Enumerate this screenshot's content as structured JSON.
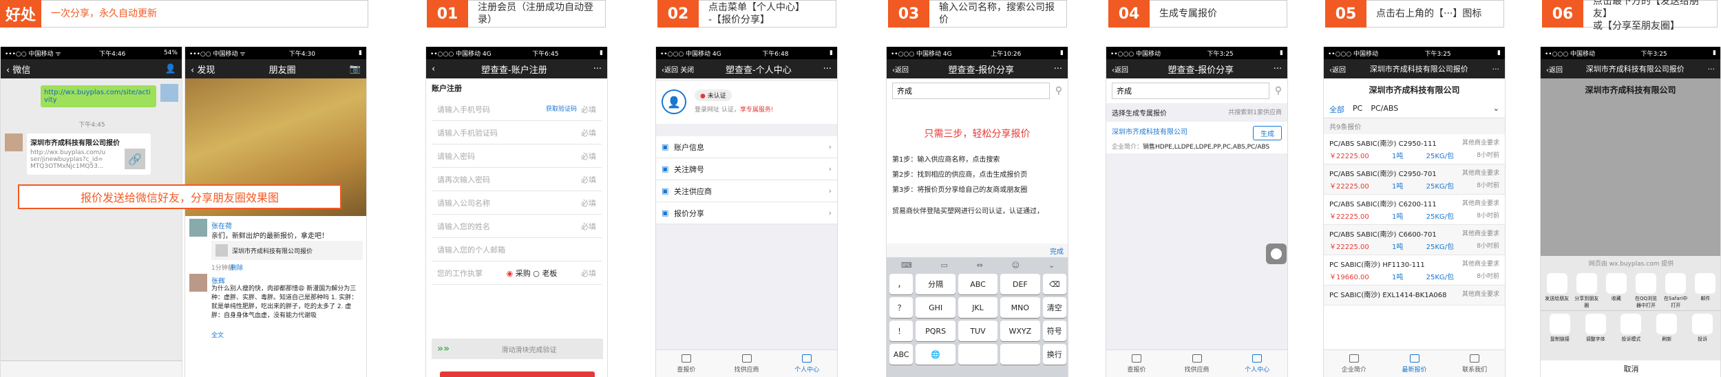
{
  "steps": [
    {
      "num": "好处",
      "text": "一次分享，永久自动更新"
    },
    {
      "num": "01",
      "text": "注册会员（注册成功自动登录）"
    },
    {
      "num": "02",
      "text1": "点击菜单【个人中心】",
      "text2": "-【报价分享】"
    },
    {
      "num": "03",
      "text": "输入公司名称，搜索公司报价"
    },
    {
      "num": "04",
      "text": "生成专属报价"
    },
    {
      "num": "05",
      "text": "点击右上角的【···】图标"
    },
    {
      "num": "06",
      "text1": "点击最下方的【发送给朋友】",
      "text2": "或【分享至朋友圈】"
    }
  ],
  "p1": {
    "status": "•••○○ 中国移动 ᯤ",
    "time": "下午4:46",
    "batt": "54%",
    "back": "微信",
    "link": "http://wx.buyplas.com/site/activity",
    "timestamp": "下午4:45",
    "card_title": "深圳市齐成科技有限公司报价",
    "card_url": "http://wx.buyplas.com/user/jinewbuyplas?c_id=MTQ3OTMxNjc1MQ53..."
  },
  "p1b": {
    "status": "•••○○ 中国移动 ᯤ",
    "time": "下午4:30",
    "back": "发现",
    "title": "朋友圈",
    "user": "张在荷",
    "post": "亲们，新鲜出炉的最新报价，拿走吧！",
    "share": "深圳市齐成科技有限公司报价",
    "ago": "1分钟前",
    "del": "删除",
    "user2": "张辉",
    "post2": "为什么别人瘦的快，肉卻都那惜😩 新漫国为解分为三种：虚胖、实胖、毒胖。知道自己是那种吗 1. 实胖：就是单纯性肥胖，吃出来的胖子，吃的太多了 2. 虚胖：自身身体气血虚，没有能力代谢吸",
    "more": "全文"
  },
  "overlay": "报价发送给微信好友，分享朋友圈效果图",
  "p2": {
    "status": "••○○○ 中国移动 4G",
    "time": "下午6:45",
    "title": "塑查查-账户注册",
    "section": "账户注册",
    "fields": [
      {
        "ph": "请输入手机号码",
        "extra": "获取验证码",
        "req": "必填"
      },
      {
        "ph": "请输入手机验证码",
        "req": "必填"
      },
      {
        "ph": "请输入密码",
        "req": "必填"
      },
      {
        "ph": "请再次输入密码",
        "req": "必填"
      },
      {
        "ph": "请输入公司名称",
        "req": "必填"
      },
      {
        "ph": "请输入您的姓名",
        "req": "必填"
      },
      {
        "ph": "请输入您的个人邮箱",
        "req": ""
      }
    ],
    "role_label": "您的工作执掌",
    "role1": "采购",
    "role2": "老板",
    "slider": "滑动滑块完成验证"
  },
  "p3": {
    "status": "••○○○ 中国移动 4G",
    "time": "下午6:48",
    "back": "返回",
    "close": "关闭",
    "title": "塑查查-个人中心",
    "badge": "未认证",
    "hint1": "登录网址",
    "hint2": "认证，",
    "hint3": "享专属服务!",
    "menu": [
      "账户信息",
      "关注牌号",
      "关注供应商",
      "报价分享"
    ],
    "tabs": [
      "查报价",
      "找供应商",
      "个人中心"
    ]
  },
  "p4": {
    "status": "••○○○ 中国移动 4G",
    "time": "上午10:26",
    "back": "返回",
    "title": "塑查查-报价分享",
    "search": "齐成",
    "promo": "只需三步，轻松分享报价",
    "s1": "第1步：输入供应商名称，点击搜索",
    "s2": "第2步：找到相应的供应商，点击生成报价页",
    "s3": "第3步：将报价页分享给自己的友商或朋友圈",
    "note": "贸易商伙伴登陆买塑网进行公司认证，认证通过，",
    "done": "完成",
    "keys": [
      [
        "，",
        "分隔",
        "ABC",
        "DEF",
        "⌫"
      ],
      [
        "？",
        "GHI",
        "JKL",
        "MNO",
        "清空"
      ],
      [
        "！",
        "PQRS",
        "TUV",
        "WXYZ",
        "符号"
      ],
      [
        "ABC",
        "🌐",
        "",
        "",
        "换行"
      ]
    ]
  },
  "p5": {
    "status": "••○○○ 中国移动",
    "time": "下午3:25",
    "back": "返回",
    "title": "塑查查-报价分享",
    "search": "齐成",
    "head": "选择生成专属报价",
    "count": "共搜索到1家供应商",
    "company": "深圳市齐成科技有限公司",
    "btn": "生成",
    "label": "企业简介：",
    "desc": "销售HDPE,LLDPE,LDPE,PP,PC,ABS,PC/ABS",
    "tabs": [
      "查报价",
      "找供应商",
      "个人中心"
    ]
  },
  "p6": {
    "status": "••○○○ 中国移动",
    "time": "下午3:25",
    "back": "返回",
    "title": "深圳市齐成科技有限公司报价",
    "company": "深圳市齐成科技有限公司",
    "filters": [
      "全部",
      "PC",
      "PC/ABS"
    ],
    "count": "共9条报价",
    "items": [
      {
        "a": "PC/ABS",
        "b": "SABIC(南沙)",
        "c": "C2950-111",
        "d": "其他商业要求",
        "p": "￥22225.00",
        "q": "1吨",
        "s": "25KG/包",
        "t": "8小时前"
      },
      {
        "a": "PC/ABS",
        "b": "SABIC(南沙)",
        "c": "C2950-701",
        "d": "其他商业要求",
        "p": "￥22225.00",
        "q": "1吨",
        "s": "25KG/包",
        "t": "8小时前"
      },
      {
        "a": "PC/ABS",
        "b": "SABIC(南沙)",
        "c": "C6200-111",
        "d": "其他商业要求",
        "p": "￥22225.00",
        "q": "1吨",
        "s": "25KG/包",
        "t": "8小时前"
      },
      {
        "a": "PC/ABS",
        "b": "SABIC(南沙)",
        "c": "C6600-701",
        "d": "其他商业要求",
        "p": "￥22225.00",
        "q": "1吨",
        "s": "25KG/包",
        "t": "8小时前"
      },
      {
        "a": "PC",
        "b": "SABIC(南沙)",
        "c": "HF1130-111",
        "d": "其他商业要求",
        "p": "￥19660.00",
        "q": "1吨",
        "s": "25KG/包",
        "t": "8小时前"
      },
      {
        "a": "PC",
        "b": "SABIC(南沙)",
        "c": "EXL1414-BK1A068",
        "d": "其他商业要求",
        "p": "",
        "q": "",
        "s": "",
        "t": ""
      }
    ],
    "bottom": [
      "企业简介",
      "最新报价",
      "联系我们"
    ]
  },
  "p7": {
    "status": "••○○○ 中国移动",
    "time": "下午3:25",
    "back": "返回",
    "title": "深圳市齐成科技有限公司报价",
    "company": "深圳市齐成科技有限公司",
    "source": "网页由 wx.buyplas.com 提供",
    "share_row": [
      "发送给朋友",
      "分享到朋友圈",
      "收藏",
      "在QQ浏览器中打开",
      "在Safari中打开",
      "邮件"
    ],
    "act_row": [
      "复制链接",
      "调整字体",
      "投诉模式",
      "刷新",
      "投诉"
    ],
    "cancel": "取消"
  }
}
